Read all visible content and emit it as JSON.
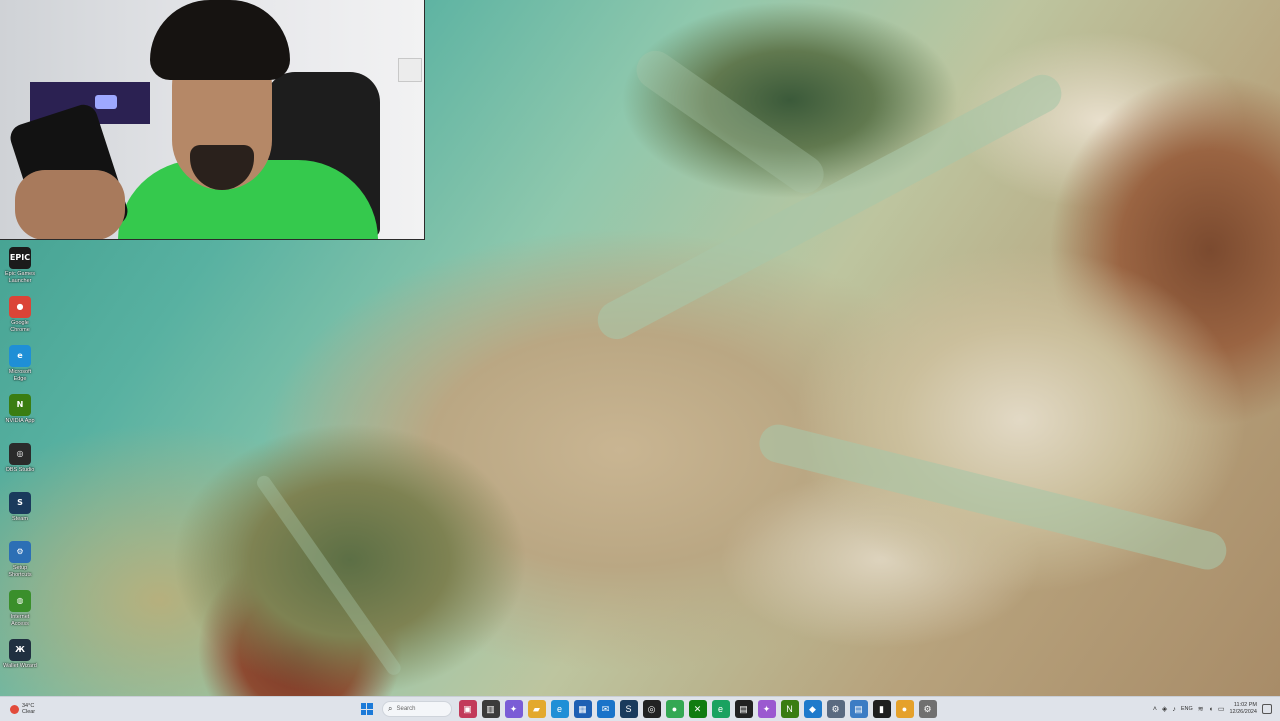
{
  "desktop": {
    "icons": [
      {
        "label": "Epic Games Launcher",
        "glyph": "EPIC",
        "icon": "epic-games-icon",
        "color": "#1b1b1b"
      },
      {
        "label": "Google Chrome",
        "glyph": "●",
        "icon": "chrome-icon",
        "color": "#db4437"
      },
      {
        "label": "Microsoft Edge",
        "glyph": "e",
        "icon": "edge-icon",
        "color": "#1f8fd6"
      },
      {
        "label": "NVIDIA App",
        "glyph": "N",
        "icon": "nvidia-icon",
        "color": "#3a7d12"
      },
      {
        "label": "OBS Studio",
        "glyph": "◎",
        "icon": "obs-icon",
        "color": "#2b2b2b"
      },
      {
        "label": "Steam",
        "glyph": "S",
        "icon": "steam-icon",
        "color": "#1a3a5c"
      },
      {
        "label": "Setup Shortcuts",
        "glyph": "⚙",
        "icon": "gear-icon",
        "color": "#2c6fb5"
      },
      {
        "label": "Internet Access",
        "glyph": "◍",
        "icon": "globe-icon",
        "color": "#3a8f2b"
      },
      {
        "label": "Wallet Wizard",
        "glyph": "Ж",
        "icon": "app-icon",
        "color": "#203040"
      }
    ]
  },
  "taskbar": {
    "weather": {
      "temp": "34°C",
      "condition": "Clear"
    },
    "search_placeholder": "Search",
    "apps": [
      {
        "icon": "media-icon",
        "glyph": "▣",
        "color": "#c23a5a"
      },
      {
        "icon": "task-view-icon",
        "glyph": "▥",
        "color": "#3b3b3b"
      },
      {
        "icon": "copilot-icon",
        "glyph": "✦",
        "color": "#7a5cd6"
      },
      {
        "icon": "file-explorer-icon",
        "glyph": "▰",
        "color": "#e3a92d"
      },
      {
        "icon": "edge-icon",
        "glyph": "e",
        "color": "#1f8fd6"
      },
      {
        "icon": "store-icon",
        "glyph": "▦",
        "color": "#1e5fb3"
      },
      {
        "icon": "mail-icon",
        "glyph": "✉",
        "color": "#1a73c9"
      },
      {
        "icon": "steam-icon",
        "glyph": "S",
        "color": "#1a3a5c"
      },
      {
        "icon": "obs-icon",
        "glyph": "◎",
        "color": "#222222"
      },
      {
        "icon": "chrome-icon",
        "glyph": "●",
        "color": "#34a853"
      },
      {
        "icon": "xbox-icon",
        "glyph": "✕",
        "color": "#107c10"
      },
      {
        "icon": "edge-dev-icon",
        "glyph": "e",
        "color": "#1aa260"
      },
      {
        "icon": "terminal-icon",
        "glyph": "▤",
        "color": "#222222"
      },
      {
        "icon": "copilot-app-icon",
        "glyph": "✦",
        "color": "#9b59d0"
      },
      {
        "icon": "nvidia-icon",
        "glyph": "N",
        "color": "#3a7d12"
      },
      {
        "icon": "vscode-icon",
        "glyph": "◆",
        "color": "#1e7acb"
      },
      {
        "icon": "settings-icon",
        "glyph": "⚙",
        "color": "#5a6a80"
      },
      {
        "icon": "notepad-icon",
        "glyph": "▤",
        "color": "#3c7cc4"
      },
      {
        "icon": "recorder-icon",
        "glyph": "▮",
        "color": "#1f1f1f"
      },
      {
        "icon": "chrome-canary-icon",
        "glyph": "●",
        "color": "#e5a12b"
      },
      {
        "icon": "gear-icon",
        "glyph": "⚙",
        "color": "#707070"
      }
    ],
    "tray": {
      "language": "ENG",
      "time": "11:02 PM",
      "date": "12/26/2024"
    }
  }
}
